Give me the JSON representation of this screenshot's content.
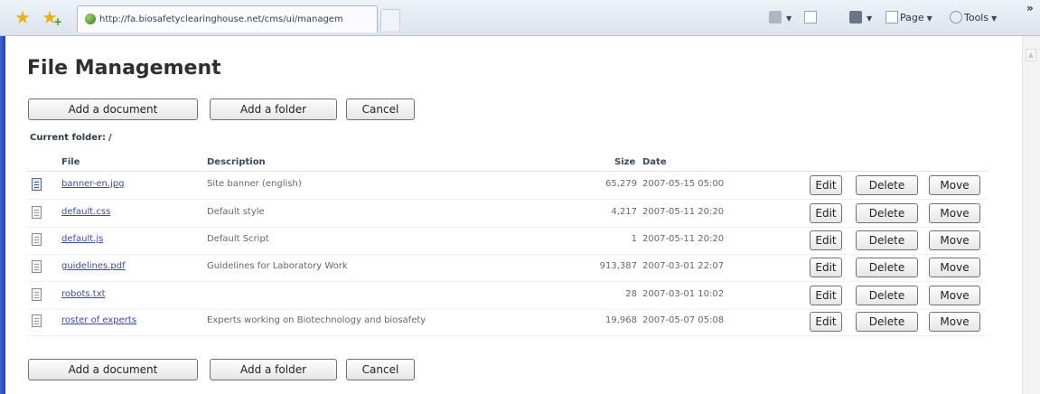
{
  "browser": {
    "tab_title": "http://fa.biosafetyclearinghouse.net/cms/ui/managem...",
    "tools": {
      "page_label": "Page",
      "tools_label": "Tools"
    }
  },
  "page": {
    "title": "File Management",
    "actions": {
      "add_document": "Add a document",
      "add_folder": "Add a folder",
      "cancel": "Cancel"
    },
    "current_folder_label": "Current folder:",
    "current_folder_value": "/",
    "table": {
      "headers": {
        "file": "File",
        "description": "Description",
        "size": "Size",
        "date": "Date"
      },
      "row_actions": {
        "edit": "Edit",
        "delete": "Delete",
        "move": "Move"
      },
      "rows": [
        {
          "icon": "image-file-icon",
          "file": "banner-en.jpg",
          "description": "Site banner (english)",
          "size": "65,279",
          "date": "2007-05-15 05:00"
        },
        {
          "icon": "text-file-icon",
          "file": "default.css",
          "description": "Default style",
          "size": "4,217",
          "date": "2007-05-11 20:20"
        },
        {
          "icon": "text-file-icon",
          "file": "default.js",
          "description": "Default Script",
          "size": "1",
          "date": "2007-05-11 20:20"
        },
        {
          "icon": "text-file-icon",
          "file": "guidelines.pdf",
          "description": "Guidelines for Laboratory Work",
          "size": "913,387",
          "date": "2007-03-01 22:07"
        },
        {
          "icon": "text-file-icon",
          "file": "robots.txt",
          "description": "",
          "size": "28",
          "date": "2007-03-01 10:02"
        },
        {
          "icon": "text-file-icon",
          "file": "roster of experts",
          "description": "Experts working on Biotechnology and biosafety",
          "size": "19,968",
          "date": "2007-05-07 05:08"
        }
      ]
    }
  }
}
